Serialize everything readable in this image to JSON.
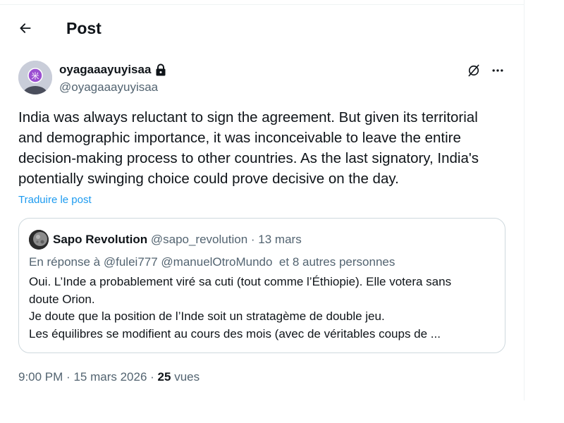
{
  "header": {
    "title": "Post",
    "back_icon": "arrow-left-icon"
  },
  "post": {
    "author": {
      "name": "oyagaaayuyisaa",
      "handle": "@oyagaaayuyisaa",
      "protected_icon": "lock-icon",
      "avatar_colors": {
        "bg": "#c9cdd9",
        "badge": "#9b4fd1"
      }
    },
    "actions": {
      "grok_icon": "grok-icon",
      "more_icon": "more-horizontal-icon"
    },
    "text_lines": [
      "India was always reluctant to sign the agreement. But given its territorial",
      "and demographic importance, it was inconceivable to leave the entire",
      "decision-making process to other countries. As the last signatory, India's",
      "potentially swinging choice could prove decisive on the day."
    ],
    "translate_label": "Traduire le post",
    "time": "9:00 PM",
    "separator": "·",
    "date": "15 mars 2026",
    "views_count": "25",
    "views_label": "vues"
  },
  "quote": {
    "author_name": "Sapo Revolution",
    "handle": "@sapo_revolution",
    "separator": "·",
    "date": "13 mars",
    "reply_prefix": "En réponse à",
    "reply_users": "@fulei777 @manuelOtroMundo",
    "reply_others": "et 8 autres personnes",
    "text_lines": [
      "Oui. L’Inde a probablement viré sa cuti (tout comme l’Éthiopie). Elle votera sans",
      "doute Orion.",
      "Je doute que la position de l’Inde soit un stratagème de double jeu.",
      "Les équilibres se modifient au cours des mois (avec de véritables coups de ..."
    ]
  },
  "colors": {
    "text_primary": "#0f1419",
    "text_secondary": "#536471",
    "link": "#1d9bf0",
    "border": "#cfd9de"
  }
}
